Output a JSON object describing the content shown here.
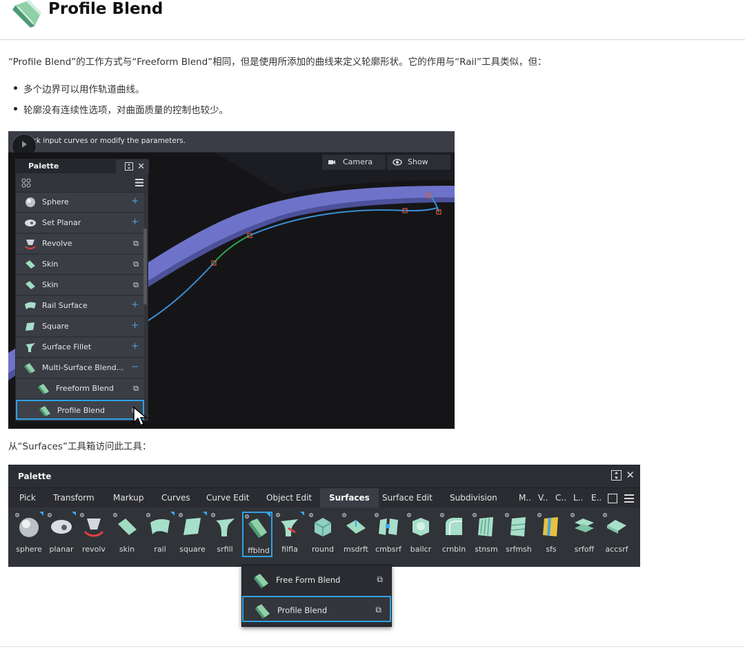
{
  "header": {
    "title": "Profile Blend",
    "icon": "profile-blend-icon"
  },
  "intro": "“Profile Blend”的工作方式与“Freeform Blend”相同，但是使用所添加的曲线来定义轮廓形状。它的作用与“Rail”工具类似，但：",
  "bullets": [
    "多个边界可以用作轨道曲线。",
    "轮廓没有连续性选项，对曲面质量的控制也较少。"
  ],
  "screenshot1": {
    "prompt": "Pick input curves or modify the parameters.",
    "camera_label": "Camera",
    "show_label": "Show",
    "palette": {
      "title": "Palette",
      "items": [
        {
          "label": "Sphere",
          "action": "+",
          "icon": "sphere-icon"
        },
        {
          "label": "Set Planar",
          "action": "+",
          "icon": "set-planar-icon"
        },
        {
          "label": "Revolve",
          "action": "copy",
          "icon": "revolve-icon"
        },
        {
          "label": "Skin",
          "action": "copy",
          "icon": "skin-icon"
        },
        {
          "label": "Skin",
          "action": "copy",
          "icon": "skin-icon"
        },
        {
          "label": "Rail Surface",
          "action": "+",
          "icon": "rail-surface-icon"
        },
        {
          "label": "Square",
          "action": "+",
          "icon": "square-icon"
        },
        {
          "label": "Surface Fillet",
          "action": "+",
          "icon": "surface-fillet-icon"
        },
        {
          "label": "Multi-Surface Blend...",
          "action": "−",
          "icon": "multi-surface-blend-icon"
        },
        {
          "label": "Freeform Blend",
          "action": "copy",
          "icon": "freeform-blend-icon"
        },
        {
          "label": "Profile Blend",
          "action": "copy",
          "icon": "profile-blend-icon"
        }
      ]
    }
  },
  "caption": "从“Surfaces”工具箱访问此工具：",
  "screenshot2": {
    "title": "Palette",
    "tabs": [
      "Pick",
      "Transform",
      "Markup",
      "Curves",
      "Curve Edit",
      "Object Edit",
      "Surfaces",
      "Surface Edit",
      "Subdivision",
      "M..",
      "V..",
      "C..",
      "L..",
      "E.."
    ],
    "active_tab": "Surfaces",
    "tools": [
      "sphere",
      "planar",
      "revolv",
      "skin",
      "rail",
      "square",
      "srfill",
      "ffblnd",
      "filfla",
      "round",
      "msdrft",
      "cmbsrf",
      "ballcr",
      "crnbln",
      "stnsm",
      "srfmsh",
      "sfs",
      "srfoff",
      "accsrf"
    ],
    "selected_tool": "ffblnd",
    "dropdown": [
      "Free Form Blend",
      "Profile Blend"
    ],
    "dropdown_selected": "Profile Blend"
  },
  "colors": {
    "accent": "#2fa3e6",
    "surface": "#6f74c8",
    "curve": "#3b8fd6",
    "curve_green": "#2fa84a"
  }
}
